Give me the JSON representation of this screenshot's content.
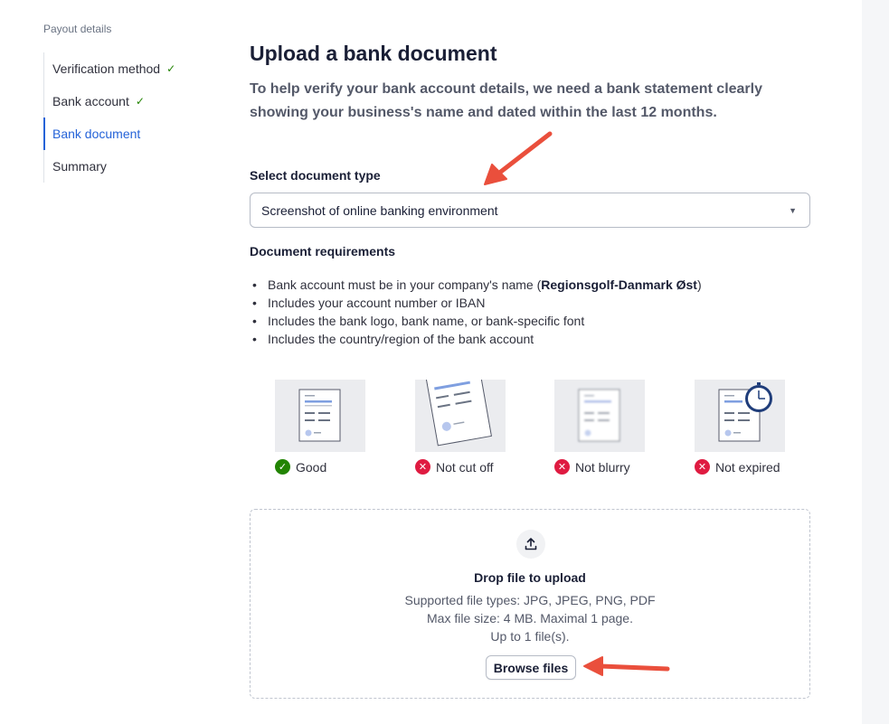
{
  "sidebar": {
    "heading": "Payout details",
    "items": [
      {
        "label": "Verification method",
        "completed": true,
        "active": false
      },
      {
        "label": "Bank account",
        "completed": true,
        "active": false
      },
      {
        "label": "Bank document",
        "completed": false,
        "active": true
      },
      {
        "label": "Summary",
        "completed": false,
        "active": false
      }
    ]
  },
  "main": {
    "title": "Upload a bank document",
    "subtitle": "To help verify your bank account details, we need a bank statement clearly showing your business's name and dated within the last 12 months.",
    "document_type": {
      "label": "Select document type",
      "selected": "Screenshot of online banking environment"
    },
    "requirements": {
      "heading": "Document requirements",
      "item1_prefix": "Bank account must be in your company's name (",
      "company_name": "Regionsgolf-Danmark Øst",
      "item1_suffix": ")",
      "item2": "Includes your account number or IBAN",
      "item3": "Includes the bank logo, bank name, or bank-specific font",
      "item4": "Includes the country/region of the bank account"
    },
    "examples": [
      {
        "label": "Good",
        "status": "ok"
      },
      {
        "label": "Not cut off",
        "status": "error"
      },
      {
        "label": "Not blurry",
        "status": "error"
      },
      {
        "label": "Not expired",
        "status": "error"
      }
    ],
    "upload": {
      "title": "Drop file to upload",
      "types": "Supported file types: JPG, JPEG, PNG, PDF",
      "size": "Max file size: 4 MB. Maximal 1 page.",
      "count": "Up to 1 file(s).",
      "browse_label": "Browse files"
    }
  },
  "colors": {
    "accent": "#2563d8",
    "success": "#228403",
    "error": "#df1b41",
    "annotation_arrow": "#ea4f3c"
  },
  "icons": [
    "check-icon",
    "caret-down-icon",
    "upload-icon",
    "success-icon",
    "error-icon",
    "clock-icon"
  ]
}
